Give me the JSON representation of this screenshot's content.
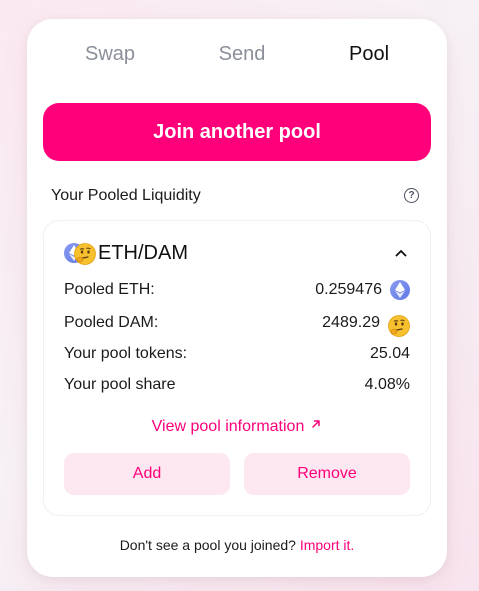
{
  "tabs": {
    "swap": "Swap",
    "send": "Send",
    "pool": "Pool",
    "active": "Pool"
  },
  "join_button": "Join another pool",
  "liquidity": {
    "header": "Your Pooled Liquidity",
    "help_icon": "?",
    "position": {
      "pair": "ETH/DAM",
      "token0_icon": "eth-icon",
      "token1_icon": "dam-thinking-face-icon",
      "rows": [
        {
          "label": "Pooled ETH:",
          "value": "0.259476"
        },
        {
          "label": "Pooled DAM:",
          "value": "2489.29"
        },
        {
          "label": "Your pool tokens:",
          "value": "25.04"
        },
        {
          "label": "Your pool share",
          "value": "4.08%"
        }
      ],
      "view_link": "View pool information",
      "add_label": "Add",
      "remove_label": "Remove"
    }
  },
  "footer": {
    "text": "Don't see a pool you joined?",
    "link": "Import it."
  },
  "colors": {
    "accent": "#ff007a",
    "accent_soft": "#fde7f0",
    "eth": "#627eea",
    "text": "#1b1b1b",
    "muted": "#8a8f9a"
  }
}
